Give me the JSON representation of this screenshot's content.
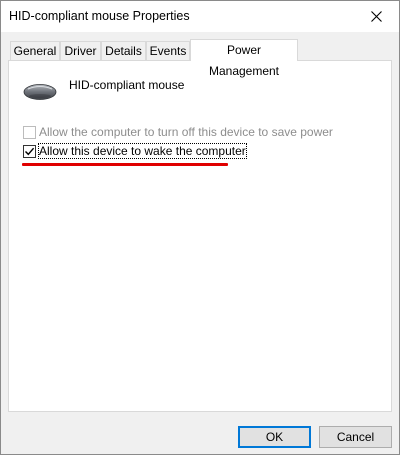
{
  "window": {
    "title": "HID-compliant mouse Properties"
  },
  "tabs": [
    {
      "label": "General"
    },
    {
      "label": "Driver"
    },
    {
      "label": "Details"
    },
    {
      "label": "Events"
    },
    {
      "label": "Power Management",
      "active": true
    }
  ],
  "device": {
    "name": "HID-compliant mouse",
    "icon": "mouse-icon"
  },
  "options": {
    "turn_off": {
      "label": "Allow the computer to turn off this device to save power",
      "checked": false,
      "enabled": false
    },
    "wake": {
      "label": "Allow this device to wake the computer",
      "checked": true,
      "enabled": true
    }
  },
  "buttons": {
    "ok": "OK",
    "cancel": "Cancel"
  },
  "colors": {
    "annotation": "#e00000",
    "default_button_border": "#0078d7"
  }
}
